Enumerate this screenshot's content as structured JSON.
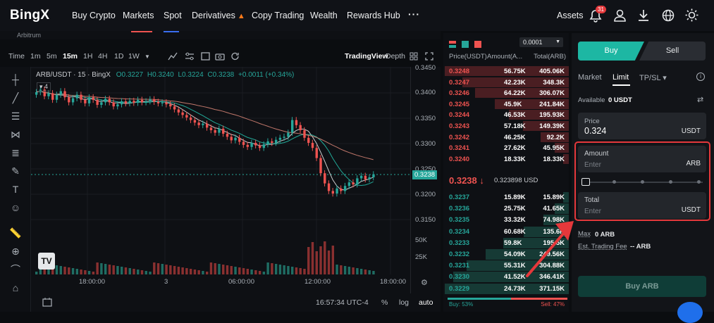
{
  "nav": {
    "logo": "BingX",
    "items": [
      "Buy Crypto",
      "Markets",
      "Spot",
      "Derivatives",
      "Copy Trading",
      "Wealth",
      "Rewards Hub"
    ],
    "more": "···",
    "assets": "Assets",
    "badge": "31"
  },
  "sub": {
    "text": "Arbitrum"
  },
  "toolbar": {
    "time_label": "Time",
    "intervals": [
      "1m",
      "5m",
      "15m",
      "1H",
      "4H",
      "1D",
      "1W"
    ],
    "active_interval": "15m",
    "views": [
      "TradingView",
      "Depth"
    ]
  },
  "chart": {
    "legend": "ARB/USDT · 15 · BingX",
    "ohlc_o": "O0.3227",
    "ohlc_h": "H0.3240",
    "ohlc_l": "L0.3224",
    "ohlc_c": "C0.3238",
    "change": "+0.0011 (+0.34%)",
    "indicator_count": "4",
    "price_axis": [
      "0.3450",
      "0.3400",
      "0.3350",
      "0.3300",
      "0.3250",
      "0.3200",
      "0.3150"
    ],
    "current_price_tag": "0.3238",
    "volume_axis": [
      "50K",
      "25K"
    ],
    "time_axis": [
      "18:00:00",
      "3",
      "06:00:00",
      "12:00:00",
      "18:00:00"
    ]
  },
  "bottom": {
    "clock": "16:57:34 UTC-4",
    "percent": "%",
    "log": "log",
    "auto": "auto"
  },
  "orderbook": {
    "step": "0.0001",
    "headers": [
      "Price(USDT)",
      "Amount(A...",
      "Total(ARB)"
    ],
    "asks": [
      [
        "0.3248",
        "56.75K",
        "405.06K"
      ],
      [
        "0.3247",
        "42.23K",
        "348.3K"
      ],
      [
        "0.3246",
        "64.22K",
        "306.07K"
      ],
      [
        "0.3245",
        "45.9K",
        "241.84K"
      ],
      [
        "0.3244",
        "46.53K",
        "195.93K"
      ],
      [
        "0.3243",
        "57.18K",
        "149.39K"
      ],
      [
        "0.3242",
        "46.25K",
        "92.2K"
      ],
      [
        "0.3241",
        "27.62K",
        "45.95K"
      ],
      [
        "0.3240",
        "18.33K",
        "18.33K"
      ]
    ],
    "last_price": "0.3238",
    "last_arrow": "↓",
    "last_usd": "0.323898 USD",
    "bids": [
      [
        "0.3237",
        "15.89K",
        "15.89K"
      ],
      [
        "0.3236",
        "25.75K",
        "41.65K"
      ],
      [
        "0.3235",
        "33.32K",
        "74.98K"
      ],
      [
        "0.3234",
        "60.68K",
        "135.6K"
      ],
      [
        "0.3233",
        "59.8K",
        "195.5K"
      ],
      [
        "0.3232",
        "54.09K",
        "249.56K"
      ],
      [
        "0.3231",
        "55.31K",
        "304.88K"
      ],
      [
        "0.3230",
        "41.52K",
        "346.41K"
      ],
      [
        "0.3229",
        "24.73K",
        "371.15K"
      ]
    ],
    "buy_ratio": "Buy: 53%",
    "sell_ratio": "Sell: 47%"
  },
  "trade": {
    "buy_tab": "Buy",
    "sell_tab": "Sell",
    "order_types": [
      "Market",
      "Limit",
      "TP/SL ▾"
    ],
    "available_label": "Available",
    "available_value": "0 USDT",
    "price_label": "Price",
    "price_value": "0.324",
    "price_unit": "USDT",
    "amount_label": "Amount",
    "amount_placeholder": "Enter",
    "amount_unit": "ARB",
    "total_label": "Total",
    "total_placeholder": "Enter",
    "total_unit": "USDT",
    "max_label": "Max",
    "max_value": "0 ARB",
    "fee_label": "Est. Trading Fee",
    "fee_value": "-- ARB",
    "submit": "Buy ARB"
  },
  "colors": {
    "up": "#26a69a",
    "down": "#ef5350",
    "accent": "#1db7a3",
    "highlight": "#e5383b"
  }
}
